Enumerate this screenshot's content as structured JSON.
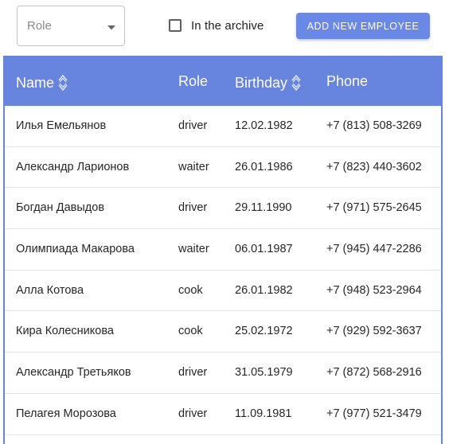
{
  "toolbar": {
    "role_select": {
      "placeholder": "Role"
    },
    "archive_checkbox": {
      "label": "In the archive",
      "checked": false
    },
    "add_button_label": "ADD NEW EMPLOYEE"
  },
  "table": {
    "columns": [
      {
        "key": "name",
        "label": "Name",
        "sortable": true
      },
      {
        "key": "role",
        "label": "Role",
        "sortable": false
      },
      {
        "key": "birthday",
        "label": "Birthday",
        "sortable": true
      },
      {
        "key": "phone",
        "label": "Phone",
        "sortable": false
      }
    ],
    "rows": [
      {
        "name": "Илья Емельянов",
        "role": "driver",
        "birthday": "12.02.1982",
        "phone": "+7 (813) 508-3269"
      },
      {
        "name": "Александр Ларионов",
        "role": "waiter",
        "birthday": "26.01.1986",
        "phone": "+7 (823) 440-3602"
      },
      {
        "name": "Богдан Давыдов",
        "role": "driver",
        "birthday": "29.11.1990",
        "phone": "+7 (971) 575-2645"
      },
      {
        "name": "Олимпиада Макарова",
        "role": "waiter",
        "birthday": "06.01.1987",
        "phone": "+7 (945) 447-2286"
      },
      {
        "name": "Алла Котова",
        "role": "cook",
        "birthday": "26.01.1982",
        "phone": "+7 (948) 523-2964"
      },
      {
        "name": "Кира Колесникова",
        "role": "cook",
        "birthday": "25.02.1972",
        "phone": "+7 (929) 592-3637"
      },
      {
        "name": "Александр Третьяков",
        "role": "driver",
        "birthday": "31.05.1979",
        "phone": "+7 (872) 568-2916"
      },
      {
        "name": "Пелагея Морозова",
        "role": "driver",
        "birthday": "11.09.1981",
        "phone": "+7 (977) 521-3479"
      }
    ]
  },
  "colors": {
    "accent": "#6784de",
    "button": "#6a88e6",
    "row_divider": "#e3e3e3"
  },
  "icons": {
    "select_caret": "caret-down-icon",
    "sort": "sort-icon"
  }
}
